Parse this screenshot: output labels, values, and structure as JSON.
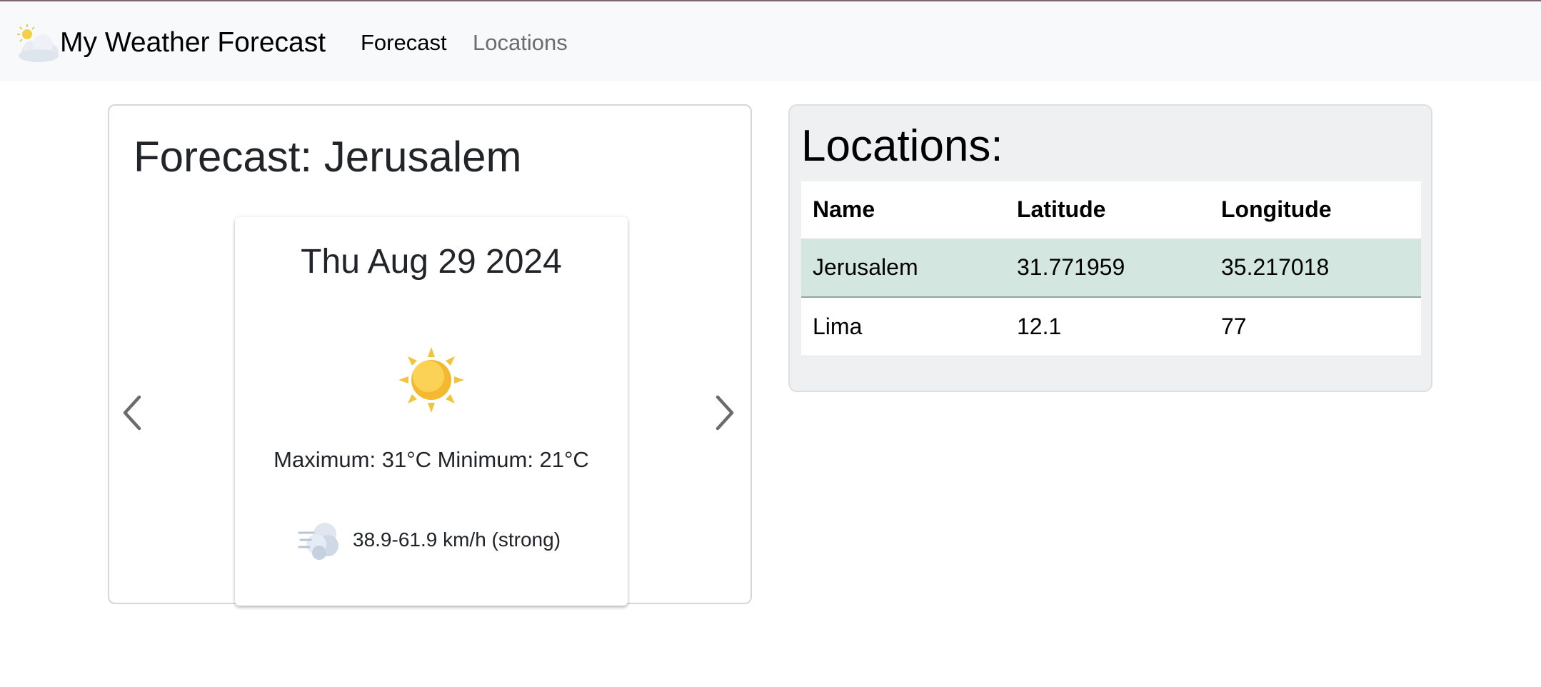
{
  "app": {
    "brand": "My Weather Forecast"
  },
  "nav": {
    "forecast_label": "Forecast",
    "locations_label": "Locations"
  },
  "forecast": {
    "title": "Forecast: Jerusalem",
    "card": {
      "date": "Thu Aug 29 2024",
      "weather_icon": "sun-icon",
      "temps": "Maximum: 31°C Minimum: 21°C",
      "wind_icon": "wind-icon",
      "wind": "38.9-61.9 km/h (strong)"
    }
  },
  "locations": {
    "title": "Locations:",
    "columns": [
      "Name",
      "Latitude",
      "Longitude"
    ],
    "rows": [
      {
        "name": "Jerusalem",
        "latitude": "31.771959",
        "longitude": "35.217018",
        "selected": true
      },
      {
        "name": "Lima",
        "latitude": "12.1",
        "longitude": "77",
        "selected": false
      }
    ]
  },
  "colors": {
    "navbar_bg": "#f8f9fa",
    "selected_row": "#d3e6df",
    "locations_panel_bg": "#eff0f1",
    "nav_inactive": "#6c6c6c"
  }
}
